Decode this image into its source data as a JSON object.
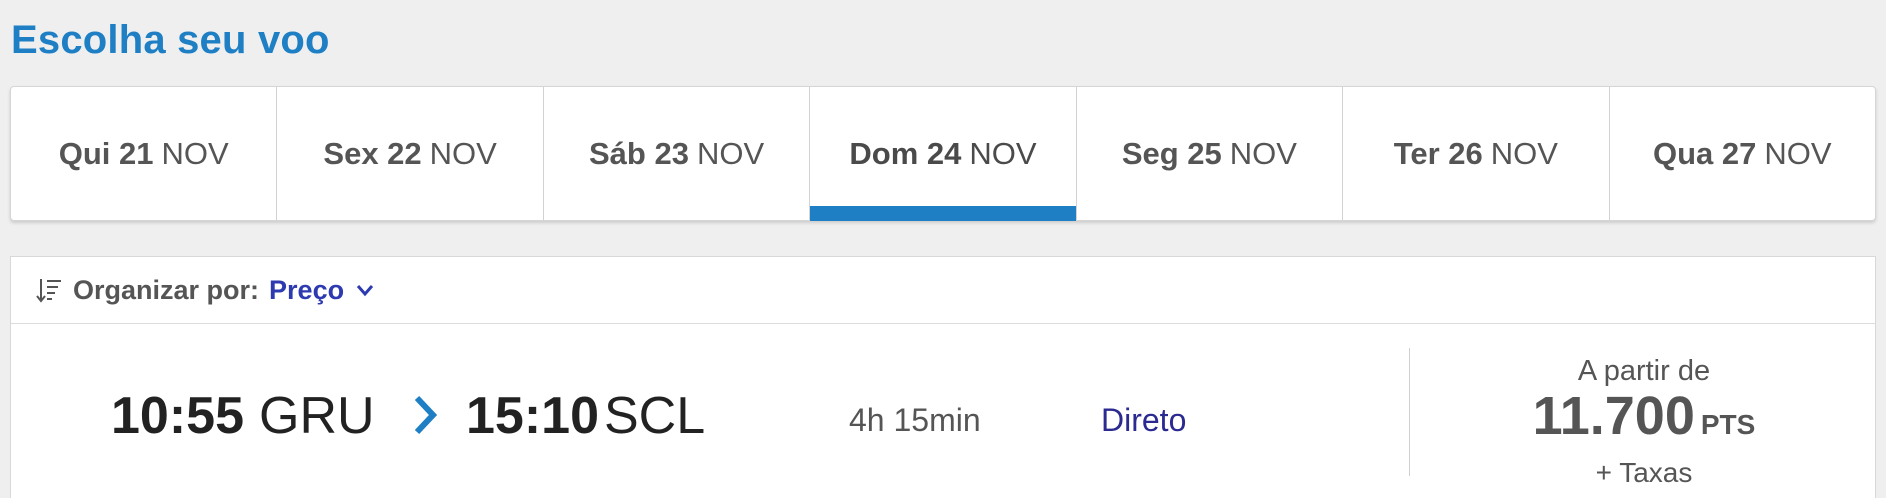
{
  "page_title": "Escolha seu voo",
  "date_tabs": [
    {
      "day": "Qui 21",
      "month": "NOV",
      "active": false
    },
    {
      "day": "Sex 22",
      "month": "NOV",
      "active": false
    },
    {
      "day": "Sáb 23",
      "month": "NOV",
      "active": false
    },
    {
      "day": "Dom 24",
      "month": "NOV",
      "active": true
    },
    {
      "day": "Seg 25",
      "month": "NOV",
      "active": false
    },
    {
      "day": "Ter 26",
      "month": "NOV",
      "active": false
    },
    {
      "day": "Qua 27",
      "month": "NOV",
      "active": false
    }
  ],
  "sort": {
    "icon": "sort-icon",
    "label": "Organizar por:",
    "value": "Preço",
    "dropdown_icon": "chevron-down-icon"
  },
  "flight": {
    "departure_time": "10:55",
    "departure_airport": "GRU",
    "arrow_icon": "chevron-right-icon",
    "arrival_time": "15:10",
    "arrival_airport": "SCL",
    "duration": "4h 15min",
    "stops": "Direto",
    "price_from_label": "A partir de",
    "price": "11.700",
    "price_unit": "PTS",
    "taxes_label": "+ Taxas"
  },
  "colors": {
    "accent": "#1e7fc4",
    "link": "#2d3ab0",
    "background": "#efefef"
  }
}
